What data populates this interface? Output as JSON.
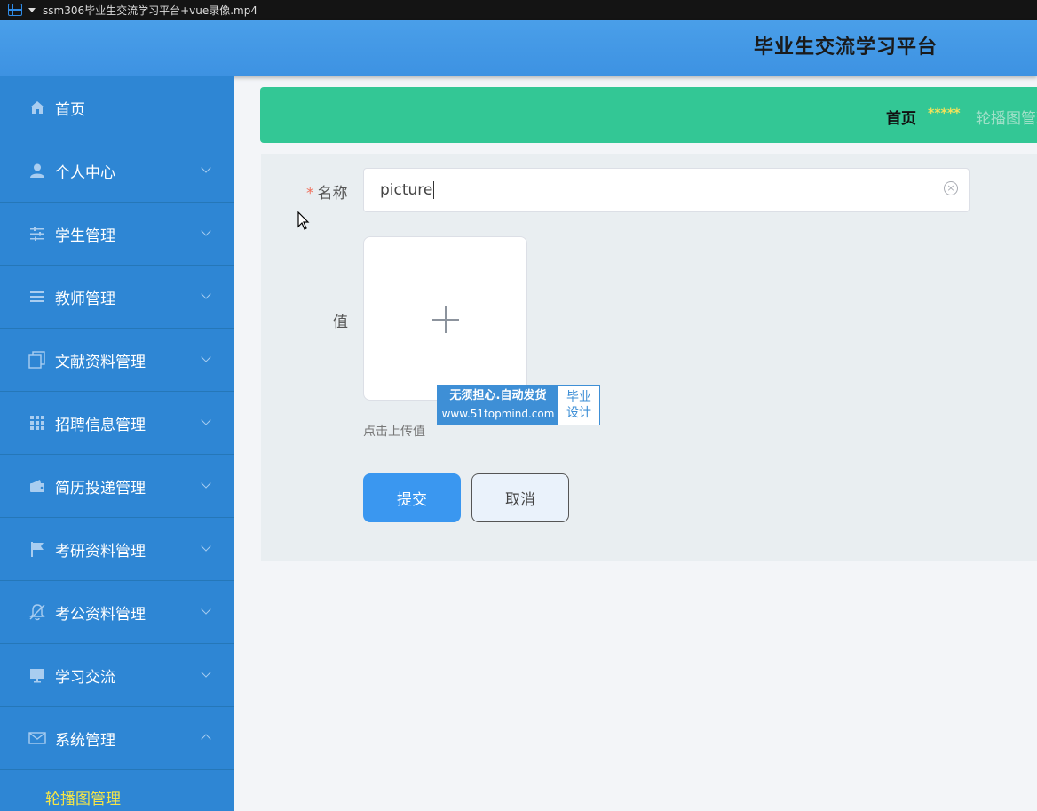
{
  "window": {
    "title": "ssm306毕业生交流学习平台+vue录像.mp4"
  },
  "header": {
    "title": "毕业生交流学习平台"
  },
  "sidebar": {
    "items": [
      {
        "label": "首页",
        "icon": "home-icon",
        "expandable": false
      },
      {
        "label": "个人中心",
        "icon": "user-icon",
        "expandable": true
      },
      {
        "label": "学生管理",
        "icon": "sliders-icon",
        "expandable": true
      },
      {
        "label": "教师管理",
        "icon": "list-icon",
        "expandable": true
      },
      {
        "label": "文献资料管理",
        "icon": "copy-icon",
        "expandable": true
      },
      {
        "label": "招聘信息管理",
        "icon": "grid-icon",
        "expandable": true
      },
      {
        "label": "简历投递管理",
        "icon": "wallet-icon",
        "expandable": true
      },
      {
        "label": "考研资料管理",
        "icon": "flag-icon",
        "expandable": true
      },
      {
        "label": "考公资料管理",
        "icon": "bell-off-icon",
        "expandable": true
      },
      {
        "label": "学习交流",
        "icon": "monitor-icon",
        "expandable": true
      },
      {
        "label": "系统管理",
        "icon": "mail-icon",
        "expandable": true,
        "expanded": true
      }
    ],
    "sub_item": {
      "label": "轮播图管理"
    }
  },
  "breadcrumb": {
    "home": "首页",
    "separator": "*****",
    "current": "轮播图管理"
  },
  "form": {
    "name_label": "名称",
    "required_mark": "*",
    "name_value": "picture",
    "clear_symbol": "×",
    "value_label": "值",
    "upload_hint": "点击上传值",
    "submit_label": "提交",
    "cancel_label": "取消"
  },
  "watermark": {
    "line1": "无须担心.自动发货",
    "line2": "www.51topmind.com",
    "side1": "毕业",
    "side2": "设计"
  },
  "colors": {
    "header": "#3d92e2",
    "sidebar": "#2e86d4",
    "breadcrumb": "#33c795",
    "accent_submit": "#3a97f0",
    "active_submenu": "#f5e547"
  }
}
